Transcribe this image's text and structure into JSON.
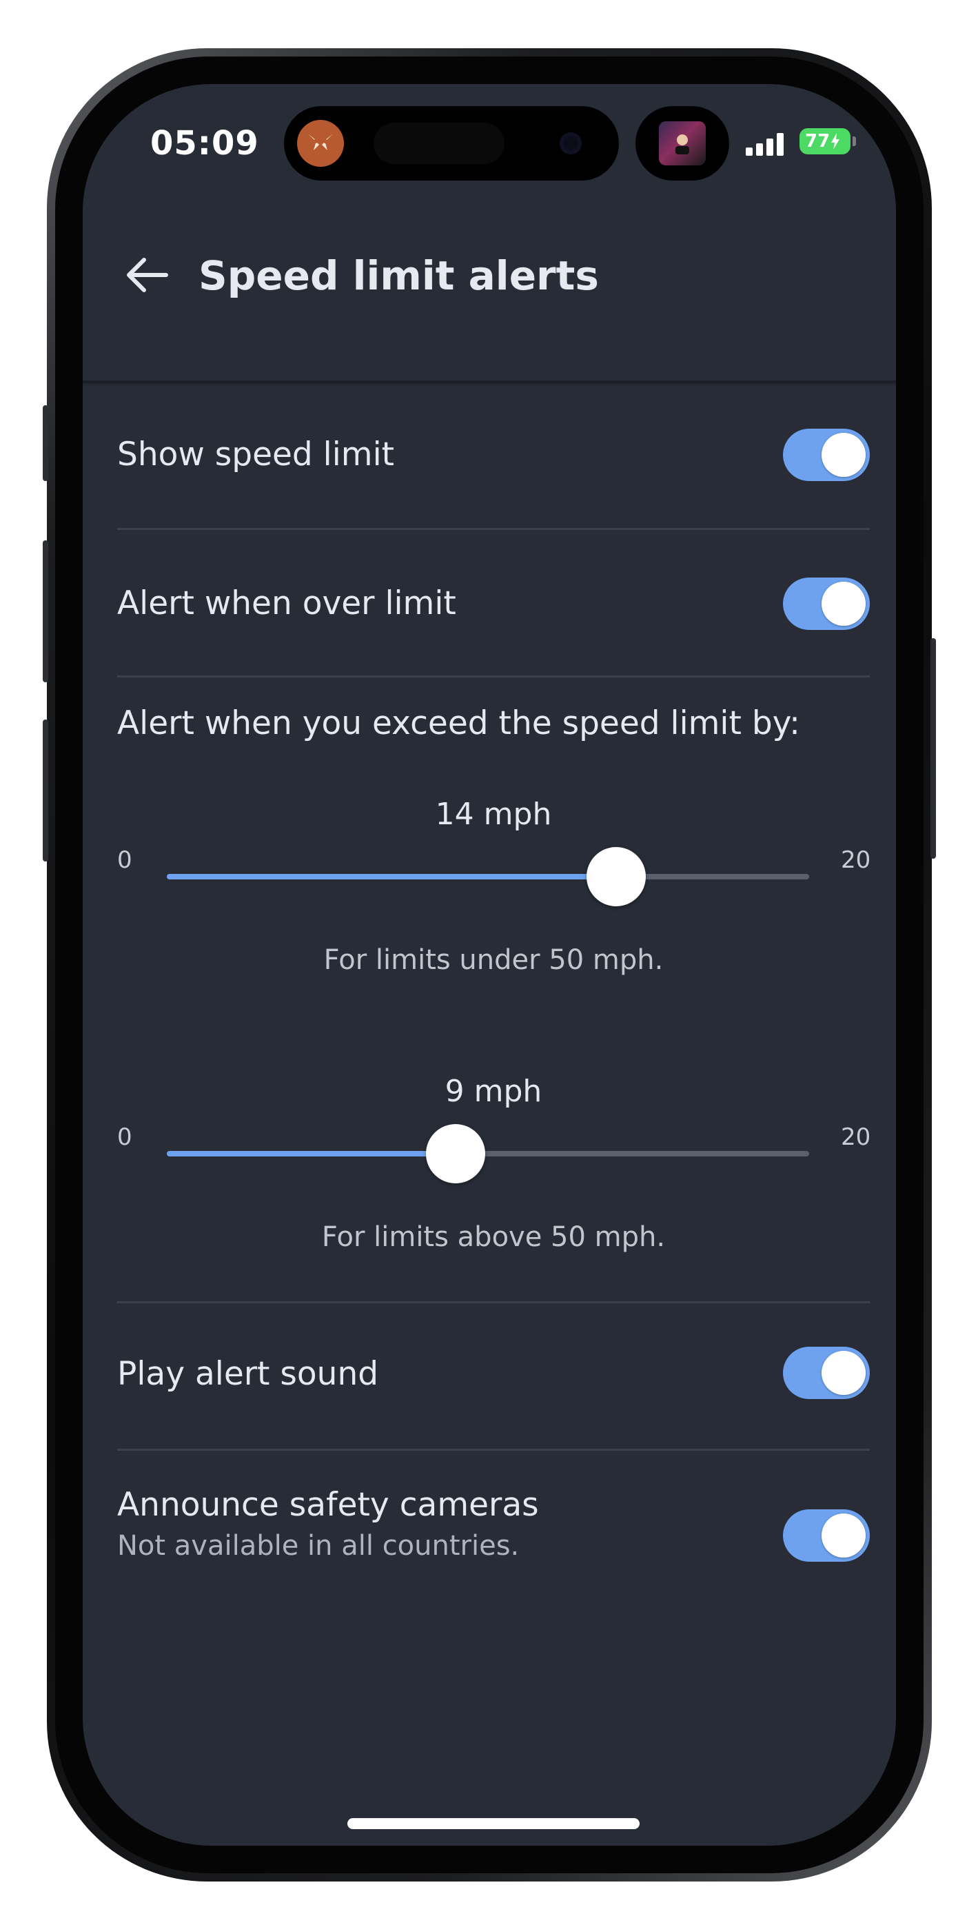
{
  "status_bar": {
    "time": "05:09",
    "battery": "77"
  },
  "header": {
    "title": "Speed limit alerts"
  },
  "settings": {
    "show_speed_limit": {
      "label": "Show speed limit",
      "enabled": true
    },
    "alert_over_limit": {
      "label": "Alert when over limit",
      "enabled": true
    },
    "exceed_prompt": "Alert when you exceed the speed limit by:",
    "sliders": [
      {
        "value_label": "14 mph",
        "value": 14,
        "min_label": "0",
        "max_label": "20",
        "min": 0,
        "max": 20,
        "caption": "For limits under 50 mph."
      },
      {
        "value_label": "9 mph",
        "value": 9,
        "min_label": "0",
        "max_label": "20",
        "min": 0,
        "max": 20,
        "caption": "For limits above 50 mph."
      }
    ],
    "play_alert_sound": {
      "label": "Play alert sound",
      "enabled": true
    },
    "safety_cameras": {
      "label": "Announce safety cameras",
      "subtitle": "Not available in all countries.",
      "enabled": true
    }
  },
  "colors": {
    "background": "#282c37",
    "accent": "#6ea2ee",
    "text_primary": "#e6e9ef",
    "text_secondary": "#aeb3bd"
  },
  "icons": {
    "back": "arrow-left-icon",
    "signal": "cellular-signal-icon",
    "battery": "battery-charging-icon"
  }
}
